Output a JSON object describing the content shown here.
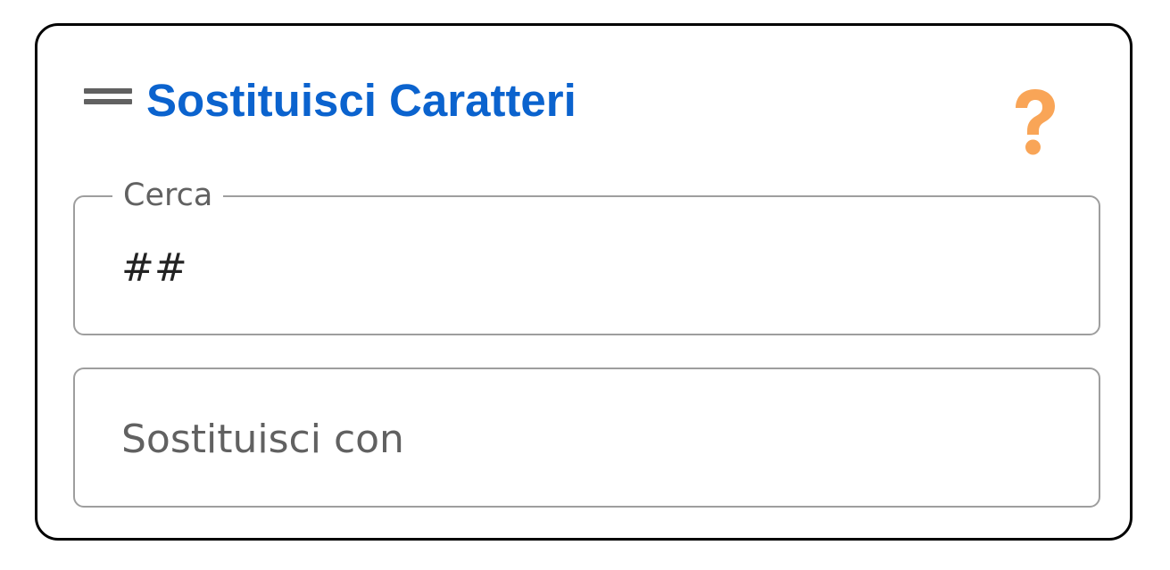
{
  "header": {
    "title": "Sostituisci Caratteri",
    "drag_icon": "drag-handle-icon",
    "help_icon": "question-mark-icon",
    "title_color": "#0b63ce",
    "help_color": "#f9a557"
  },
  "search": {
    "label": "Cerca",
    "value": "##"
  },
  "replace": {
    "placeholder": "Sostituisci con",
    "value": ""
  }
}
